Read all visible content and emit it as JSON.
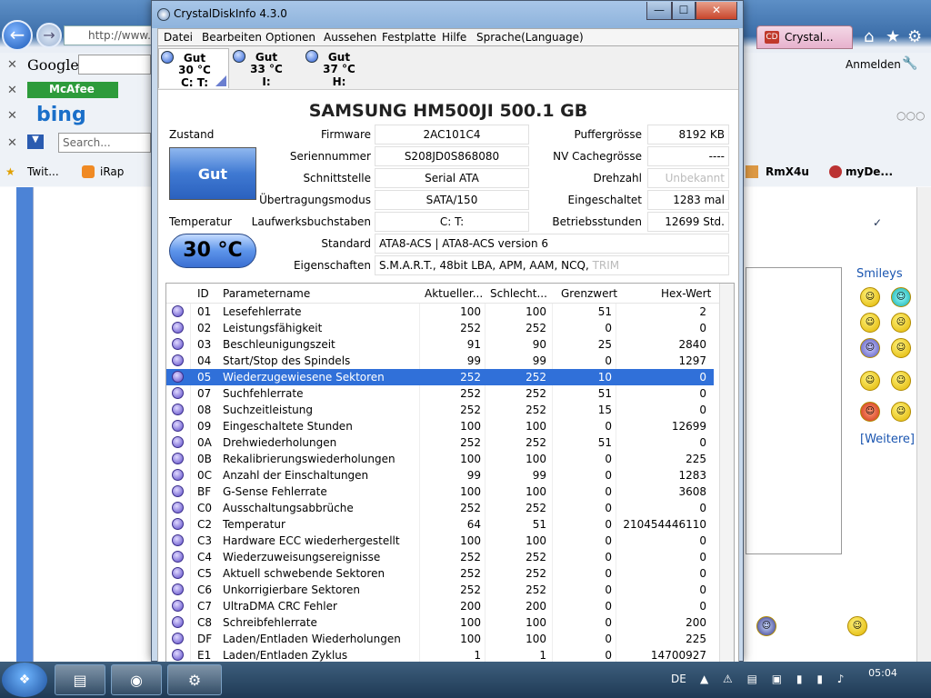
{
  "browser": {
    "address": "http://www.c",
    "tab_crystal": "Crystal...",
    "google_label": "Google",
    "mcafee_label": "McAfee",
    "bing_label": "bing",
    "search_placeholder": "Search...",
    "fav_items": [
      "Twit...",
      "iRap"
    ],
    "anmelden": "Anmelden",
    "right_fav": [
      "RmX4u",
      "myDe..."
    ],
    "smileys_title": "Smileys",
    "weitere": "[Weitere]"
  },
  "window": {
    "title": "CrystalDiskInfo 4.3.0",
    "menu": [
      "Datei",
      "Bearbeiten",
      "Optionen",
      "Aussehen",
      "Festplatte",
      "Hilfe",
      "Sprache(Language)"
    ]
  },
  "disks": [
    {
      "status": "Gut",
      "temp": "30 °C",
      "letter": "C: T:"
    },
    {
      "status": "Gut",
      "temp": "33 °C",
      "letter": "I:"
    },
    {
      "status": "Gut",
      "temp": "37 °C",
      "letter": "H:"
    }
  ],
  "model": "SAMSUNG HM500JI  500.1 GB",
  "status": {
    "zustand_label": "Zustand",
    "zustand_value": "Gut",
    "temp_label": "Temperatur",
    "temp_value": "30 °C"
  },
  "info": {
    "firmware_label": "Firmware",
    "firmware": "2AC101C4",
    "serial_label": "Seriennummer",
    "serial": "S208JD0S868080",
    "interface_label": "Schnittstelle",
    "interface": "Serial ATA",
    "transfer_label": "Übertragungsmodus",
    "transfer": "SATA/150",
    "drive_label": "Laufwerksbuchstaben",
    "drive": "C: T:",
    "standard_label": "Standard",
    "standard": "ATA8-ACS | ATA8-ACS version 6",
    "features_label": "Eigenschaften",
    "features": "S.M.A.R.T., 48bit LBA, APM, AAM, NCQ, ",
    "features_gray": "TRIM",
    "buffer_label": "Puffergrösse",
    "buffer": "8192 KB",
    "nvcache_label": "NV Cachegrösse",
    "nvcache": "----",
    "rpm_label": "Drehzahl",
    "rpm": "Unbekannt",
    "poweron_label": "Eingeschaltet",
    "poweron": "1283 mal",
    "hours_label": "Betriebsstunden",
    "hours": "12699 Std."
  },
  "smart": {
    "headers": [
      "ID",
      "Parametername",
      "Aktueller...",
      "Schlecht...",
      "Grenzwert",
      "Hex-Wert"
    ],
    "rows": [
      [
        "01",
        "Lesefehlerrate",
        "100",
        "100",
        "51",
        "2"
      ],
      [
        "02",
        "Leistungsfähigkeit",
        "252",
        "252",
        "0",
        "0"
      ],
      [
        "03",
        "Beschleunigungszeit",
        "91",
        "90",
        "25",
        "2840"
      ],
      [
        "04",
        "Start/Stop des Spindels",
        "99",
        "99",
        "0",
        "1297"
      ],
      [
        "05",
        "Wiederzugewiesene Sektoren",
        "252",
        "252",
        "10",
        "0"
      ],
      [
        "07",
        "Suchfehlerrate",
        "252",
        "252",
        "51",
        "0"
      ],
      [
        "08",
        "Suchzeitleistung",
        "252",
        "252",
        "15",
        "0"
      ],
      [
        "09",
        "Eingeschaltete Stunden",
        "100",
        "100",
        "0",
        "12699"
      ],
      [
        "0A",
        "Drehwiederholungen",
        "252",
        "252",
        "51",
        "0"
      ],
      [
        "0B",
        "Rekalibrierungswiederholungen",
        "100",
        "100",
        "0",
        "225"
      ],
      [
        "0C",
        "Anzahl der Einschaltungen",
        "99",
        "99",
        "0",
        "1283"
      ],
      [
        "BF",
        "G-Sense Fehlerrate",
        "100",
        "100",
        "0",
        "3608"
      ],
      [
        "C0",
        "Ausschaltungsabbrüche",
        "252",
        "252",
        "0",
        "0"
      ],
      [
        "C2",
        "Temperatur",
        "64",
        "51",
        "0",
        "210454446110"
      ],
      [
        "C3",
        "Hardware ECC wiederhergestellt",
        "100",
        "100",
        "0",
        "0"
      ],
      [
        "C4",
        "Wiederzuweisungsereignisse",
        "252",
        "252",
        "0",
        "0"
      ],
      [
        "C5",
        "Aktuell schwebende Sektoren",
        "252",
        "252",
        "0",
        "0"
      ],
      [
        "C6",
        "Unkorrigierbare Sektoren",
        "252",
        "252",
        "0",
        "0"
      ],
      [
        "C7",
        "UltraDMA CRC Fehler",
        "200",
        "200",
        "0",
        "0"
      ],
      [
        "C8",
        "Schreibfehlerrate",
        "100",
        "100",
        "0",
        "200"
      ],
      [
        "DF",
        "Laden/Entladen Wiederholungen",
        "100",
        "100",
        "0",
        "225"
      ],
      [
        "E1",
        "Laden/Entladen Zyklus",
        "1",
        "1",
        "0",
        "14700927"
      ]
    ],
    "selected_index": 4
  },
  "taskbar": {
    "language": "DE",
    "time": "05:04"
  },
  "colors": {
    "accent": "#3070d9",
    "good": "#3f79d2",
    "close": "#c8452c"
  }
}
